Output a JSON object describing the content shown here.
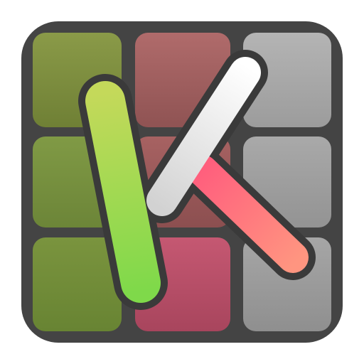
{
  "icon": {
    "name": "k-app-icon",
    "colors": {
      "frame": "#444444",
      "frame_inner": "#3d3d3d",
      "outline": "#3a3a3a",
      "tiles": {
        "top_left": [
          "#8a9a48",
          "#6f8035"
        ],
        "top_middle": [
          "#b06b6b",
          "#8f5353"
        ],
        "top_right": [
          "#b4b4b4",
          "#9c9c9c"
        ],
        "middle_left": [
          "#809a45",
          "#6c8538"
        ],
        "middle_middle": [
          "#a76262",
          "#8c4f50"
        ],
        "middle_right": [
          "#a9a9a9",
          "#939393"
        ],
        "bottom_left": [
          "#7a943e",
          "#688433"
        ],
        "bottom_middle": [
          "#c55872",
          "#a8455d"
        ],
        "bottom_right": [
          "#a6a6a6",
          "#8f8f8f"
        ]
      },
      "bar_green": [
        "#c4d95a",
        "#7fd94a"
      ],
      "bar_white": [
        "#ffffff",
        "#d2d2d2"
      ],
      "bar_pink": [
        "#ff5f7d",
        "#ff9580"
      ]
    }
  }
}
